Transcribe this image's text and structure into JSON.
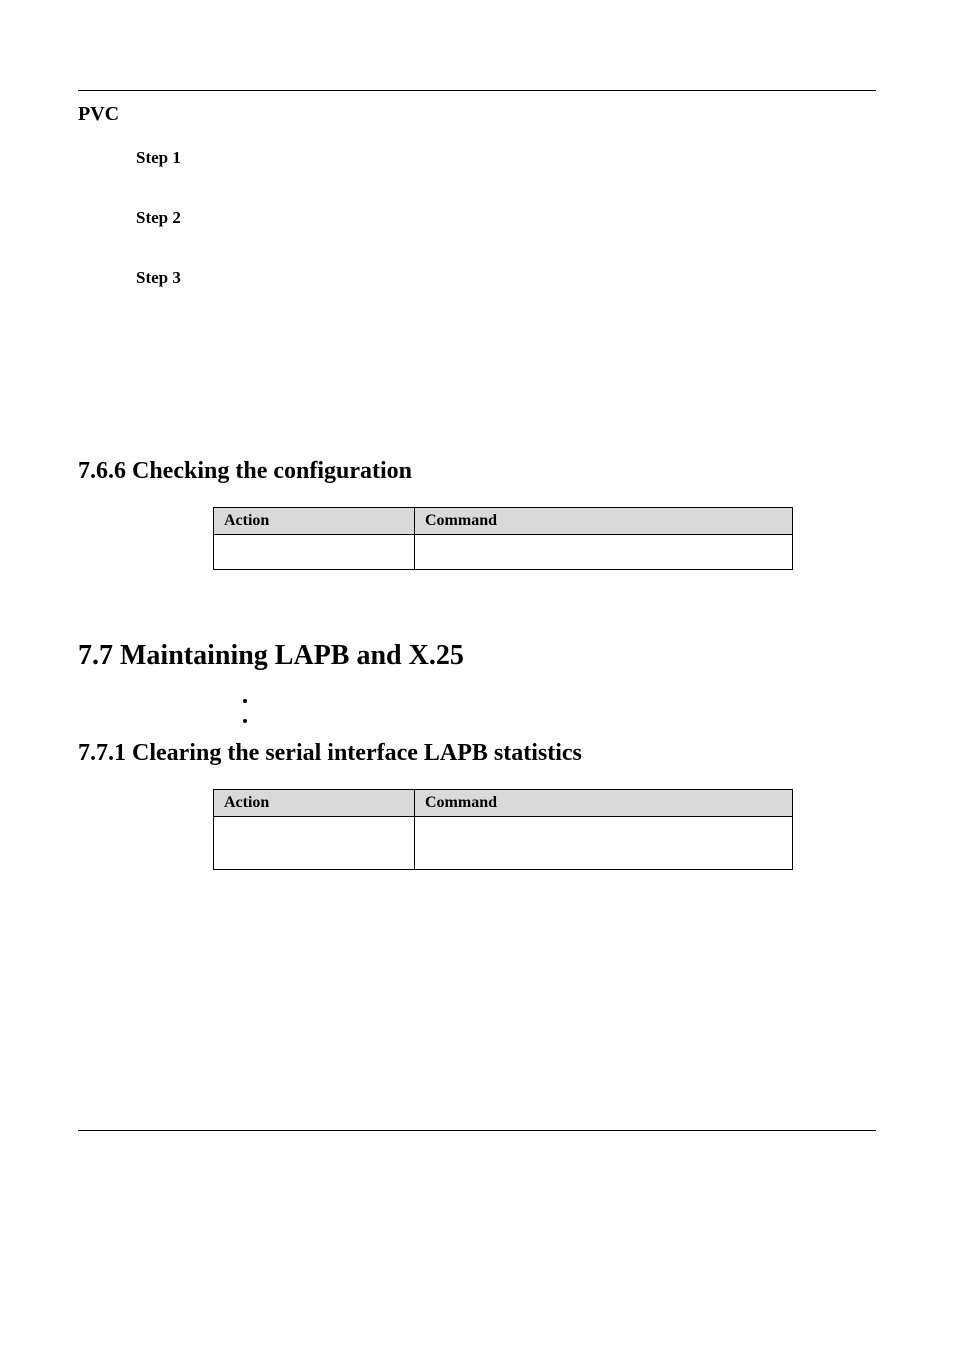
{
  "pvc_heading": "PVC",
  "steps": [
    {
      "label": "Step 1"
    },
    {
      "label": "Step 2"
    },
    {
      "label": "Step 3"
    }
  ],
  "section_766": "7.6.6 Checking the configuration",
  "section_77": "7.7 Maintaining LAPB and X.25",
  "section_771": "7.7.1 Clearing the serial interface LAPB statistics",
  "table_headers": {
    "action": "Action",
    "command": "Command"
  },
  "table_766": {
    "rows": [
      {
        "action": "",
        "command": ""
      }
    ]
  },
  "bullets_77": [
    "",
    ""
  ],
  "table_771": {
    "rows": [
      {
        "action": "",
        "command": ""
      }
    ]
  }
}
